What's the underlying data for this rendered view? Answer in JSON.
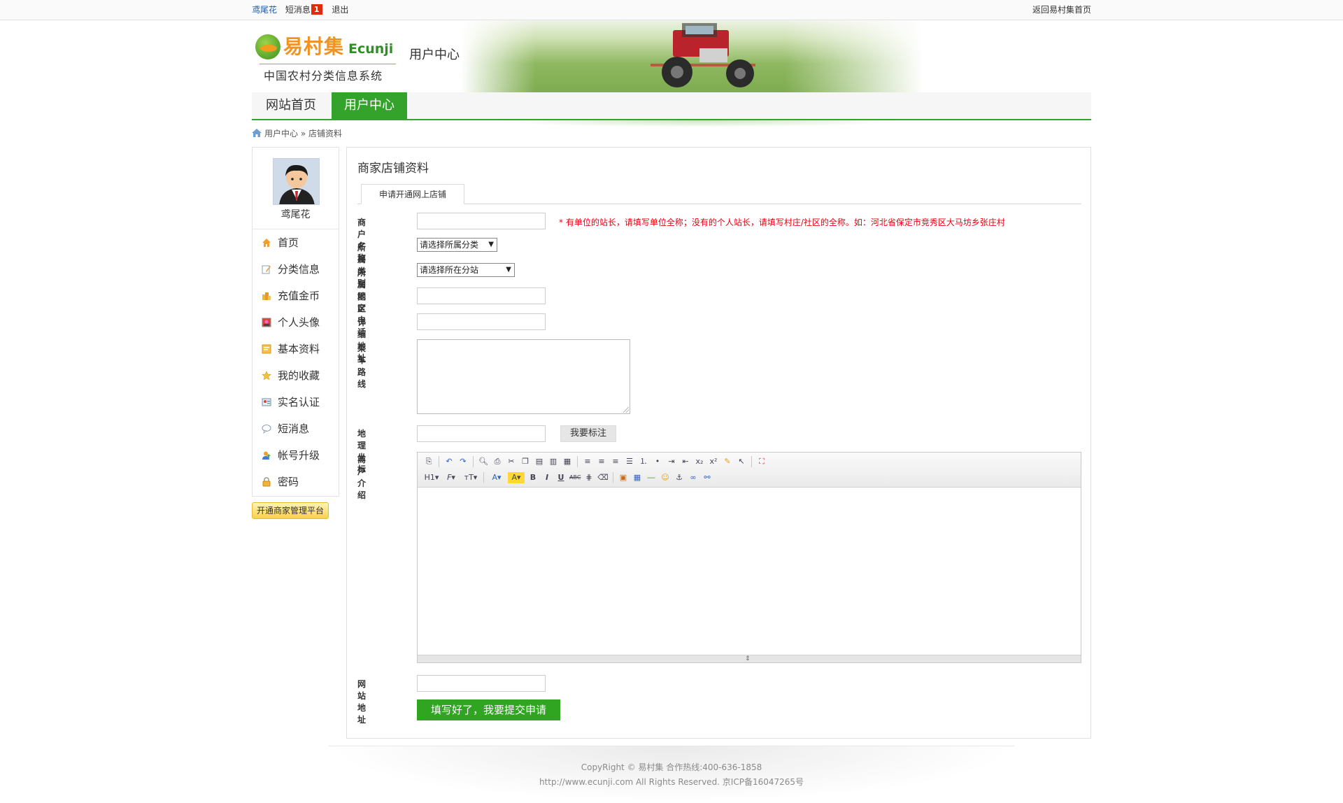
{
  "topbar": {
    "username": "鸢尾花",
    "messages_label": "短消息",
    "messages_count": "1",
    "logout": "退出",
    "home_link": "返回易村集首页"
  },
  "header": {
    "logo_cn": "易村集",
    "logo_en": "Ecunji",
    "logo_sub": "中国农村分类信息系统",
    "section_title": "用户中心"
  },
  "nav": {
    "tabs": [
      {
        "label": "网站首页",
        "active": false
      },
      {
        "label": "用户中心",
        "active": true
      }
    ]
  },
  "breadcrumb": {
    "root": "用户中心",
    "separator": "»",
    "current": "店铺资料"
  },
  "sidebar": {
    "username": "鸢尾花",
    "menu": [
      {
        "label": "首页",
        "icon": "home-icon"
      },
      {
        "label": "分类信息",
        "icon": "edit-note-icon"
      },
      {
        "label": "充值金币",
        "icon": "coins-icon"
      },
      {
        "label": "个人头像",
        "icon": "portrait-icon"
      },
      {
        "label": "基本资料",
        "icon": "profile-card-icon"
      },
      {
        "label": "我的收藏",
        "icon": "star-icon"
      },
      {
        "label": "实名认证",
        "icon": "id-card-icon"
      },
      {
        "label": "短消息",
        "icon": "chat-bubble-icon"
      },
      {
        "label": "帐号升级",
        "icon": "user-upgrade-icon"
      },
      {
        "label": "密码",
        "icon": "lock-icon"
      }
    ],
    "open_platform_button": "开通商家管理平台"
  },
  "panel": {
    "title": "商家店铺资料",
    "tab": "申请开通网上店铺",
    "fields": {
      "shop_name_label": "商户名称",
      "shop_name_value": "",
      "shop_name_hint": "* 有单位的站长，请填写单位全称；没有的个人站长，请填写村庄/社区的全称。如：河北省保定市竞秀区大马坊乡张庄村",
      "category_label": "所属类别",
      "category_selected": "请选择所属分类",
      "region_label": "所属地区",
      "region_selected": "请选择所在分站",
      "phone_label": "固定电话",
      "phone_value": "",
      "address_label": "详细地址",
      "address_value": "",
      "route_label": "乘车路线",
      "route_value": "",
      "geo_label": "地理坐标",
      "geo_value": "",
      "geo_button": "我要标注",
      "intro_label": "商户介绍",
      "website_label": "网站地址",
      "website_value": ""
    },
    "submit": "填写好了，我要提交申请"
  },
  "editor": {
    "row1": [
      "source-icon",
      "undo-icon",
      "redo-icon",
      "preview-icon",
      "print-icon",
      "cut-icon",
      "copy-icon",
      "paste-icon",
      "paste-text-icon",
      "paste-word-icon",
      "align-left-icon",
      "align-center-icon",
      "align-right-icon",
      "justify-icon",
      "ordered-list-icon",
      "unordered-list-icon",
      "indent-icon",
      "outdent-icon",
      "subscript-icon",
      "superscript-icon",
      "format-brush-icon",
      "select-all-icon",
      "fullscreen-icon"
    ],
    "row2": [
      "heading-icon",
      "font-family-icon",
      "font-size-icon",
      "font-color-icon",
      "highlight-icon",
      "bold-icon",
      "italic-icon",
      "underline-icon",
      "strikethrough-icon",
      "line-height-icon",
      "remove-format-icon",
      "image-icon",
      "table-icon",
      "horizontal-rule-icon",
      "emoticon-icon",
      "anchor-icon",
      "link-icon",
      "unlink-icon"
    ]
  },
  "footer": {
    "line1": "CopyRight © 易村集 合作热线:400-636-1858",
    "line2": "http://www.ecunji.com All Rights Reserved. 京ICP备16047265号"
  },
  "colors": {
    "brand_green": "#34a32b",
    "submit_green": "#2fa521",
    "hint_red": "#e60012",
    "badge_red": "#e02b0a",
    "logo_orange": "#f19320"
  }
}
